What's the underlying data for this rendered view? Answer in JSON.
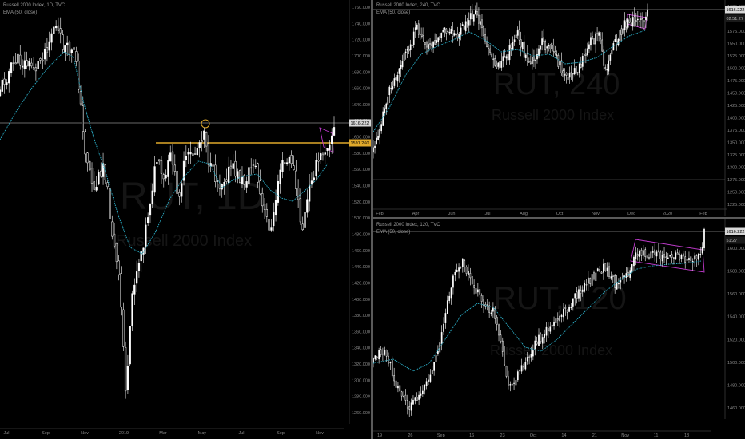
{
  "colors": {
    "background": "#000000",
    "candle": "#ffffff",
    "ema": "#2aa9c2",
    "support_line": "#e0a92b",
    "channel": "#c03acd",
    "level_line": "#cfcfcf",
    "text": "#9a9a9a"
  },
  "panes": [
    {
      "id": "left",
      "title": "Russell 2000 Index, 1D, TVC",
      "indicator": "EMA (50, close)",
      "watermark_symbol": "RUT, 1D",
      "watermark_name": "Russell 2000 Index",
      "price_labels": [
        "1760.000",
        "1740.000",
        "1720.000",
        "1700.000",
        "1680.000",
        "1660.000",
        "1640.000",
        "1620.000",
        "1600.000",
        "1580.000",
        "1560.000",
        "1540.000",
        "1520.000",
        "1500.000",
        "1480.000",
        "1460.000",
        "1440.000",
        "1420.000",
        "1400.000",
        "1380.000",
        "1360.000",
        "1340.000",
        "1320.000",
        "1300.000",
        "1280.000",
        "1260.000"
      ],
      "time_labels": [
        "Jul",
        "Sep",
        "Nov",
        "2019",
        "Mar",
        "May",
        "Jul",
        "Sep",
        "Nov"
      ],
      "current_price": "1616.222",
      "support_price": "1591.260",
      "chart_data": {
        "type": "candlestick",
        "x_range": [
          "Jul 2018",
          "Nov 2019"
        ],
        "ylim": [
          1260,
          1760
        ],
        "series": [
          {
            "name": "Russell 2000 Index",
            "values_approx": [
              1640,
              1665,
              1690,
              1705,
              1742,
              1710,
              1680,
              1620,
              1560,
              1500,
              1470,
              1520,
              1410,
              1300,
              1380,
              1460,
              1520,
              1560,
              1570,
              1590,
              1580,
              1540,
              1600,
              1610,
              1560,
              1500,
              1530,
              1580,
              1570,
              1540,
              1470,
              1490,
              1560,
              1590,
              1600,
              1616
            ]
          },
          {
            "name": "EMA (50, close)",
            "values_approx": [
              1620,
              1640,
              1660,
              1680,
              1700,
              1705,
              1690,
              1640,
              1600,
              1560,
              1530,
              1510,
              1480,
              1450,
              1440,
              1450,
              1470,
              1500,
              1520,
              1540,
              1550,
              1540,
              1550,
              1560,
              1560,
              1550,
              1540,
              1550,
              1560,
              1555,
              1530,
              1515,
              1520,
              1540,
              1560,
              1575
            ]
          }
        ]
      }
    },
    {
      "id": "top-right",
      "title": "Russell 2000 Index, 240, TVC",
      "indicator": "EMA (50, close)",
      "watermark_symbol": "RUT, 240",
      "watermark_name": "Russell 2000 Index",
      "price_labels": [
        "1625.000",
        "1600.000",
        "1575.000",
        "1550.000",
        "1525.000",
        "1500.000",
        "1475.000",
        "1450.000",
        "1425.000",
        "1400.000",
        "1375.000",
        "1350.000",
        "1325.000",
        "1300.000",
        "1275.000",
        "1250.000",
        "1225.000"
      ],
      "time_labels": [
        "Feb",
        "Apr",
        "Jun",
        "Jul",
        "Aug",
        "Oct",
        "Nov",
        "Dec",
        "2020",
        "Feb"
      ],
      "current_price": "1616.222",
      "countdown": "02:51:27"
    },
    {
      "id": "bottom-right",
      "title": "Russell 2000 Index, 120, TVC",
      "indicator": "EMA (50, close)",
      "watermark_symbol": "RUT, 120",
      "watermark_name": "Russell 2000 Index",
      "price_labels": [
        "1600.000",
        "1580.000",
        "1560.000",
        "1540.000",
        "1520.000",
        "1500.000",
        "1480.000",
        "1460.000"
      ],
      "time_labels": [
        "19",
        "26",
        "Sep",
        "16",
        "23",
        "Oct",
        "14",
        "21",
        "Nov",
        "11",
        "18"
      ],
      "current_price": "1616.222",
      "countdown": "51:27"
    }
  ]
}
